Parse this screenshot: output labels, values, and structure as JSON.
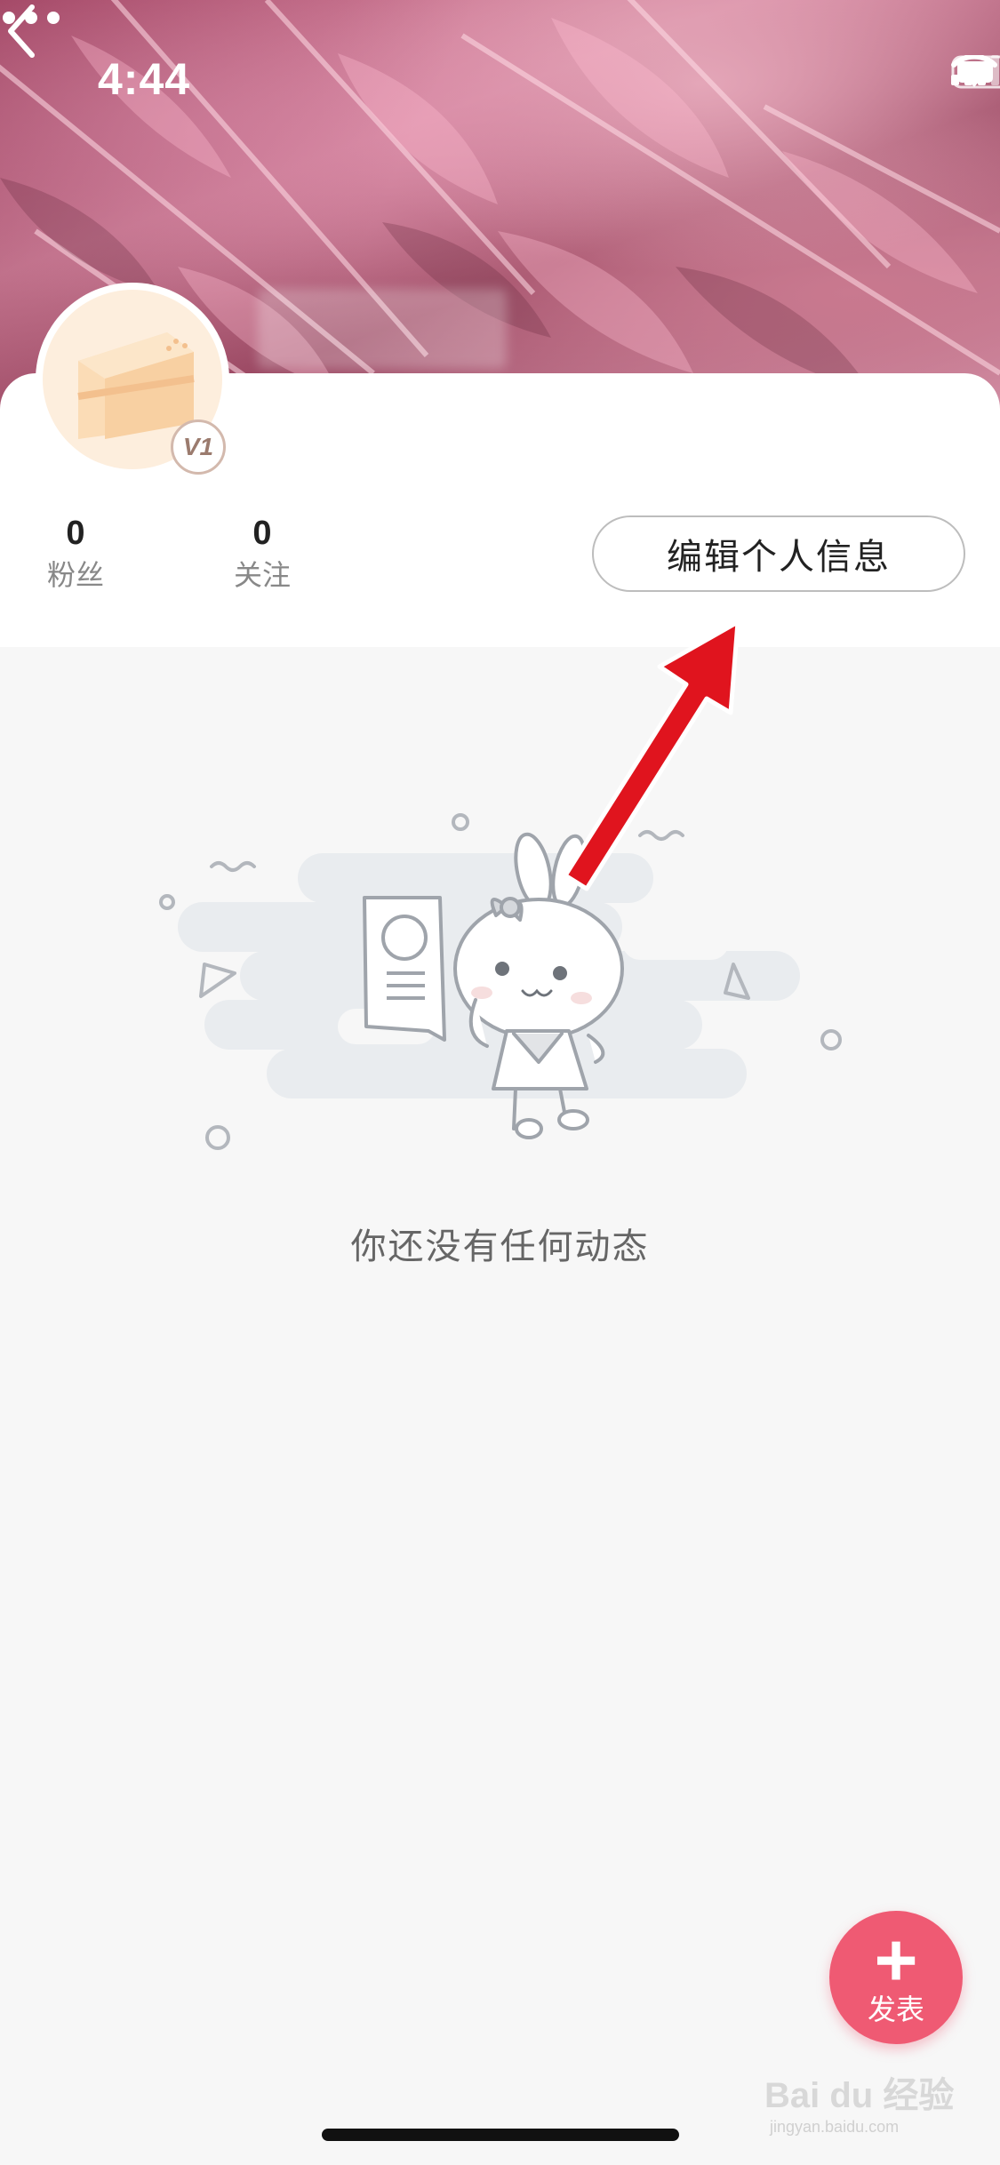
{
  "status_bar": {
    "time": "4:44"
  },
  "header": {
    "back_icon": "chevron-left-icon",
    "more_icon": "more-horizontal-icon"
  },
  "profile": {
    "level_badge": "V1",
    "stats": [
      {
        "value": "0",
        "label": "粉丝"
      },
      {
        "value": "0",
        "label": "关注"
      }
    ],
    "edit_button_label": "编辑个人信息"
  },
  "feed": {
    "empty_text": "你还没有任何动态"
  },
  "fab": {
    "label": "发表",
    "icon": "plus-icon"
  },
  "watermark": {
    "main": "Bai du 经验",
    "sub": "jingyan.baidu.com"
  },
  "colors": {
    "accent": "#ef5a73",
    "arrow": "#e0141e"
  }
}
